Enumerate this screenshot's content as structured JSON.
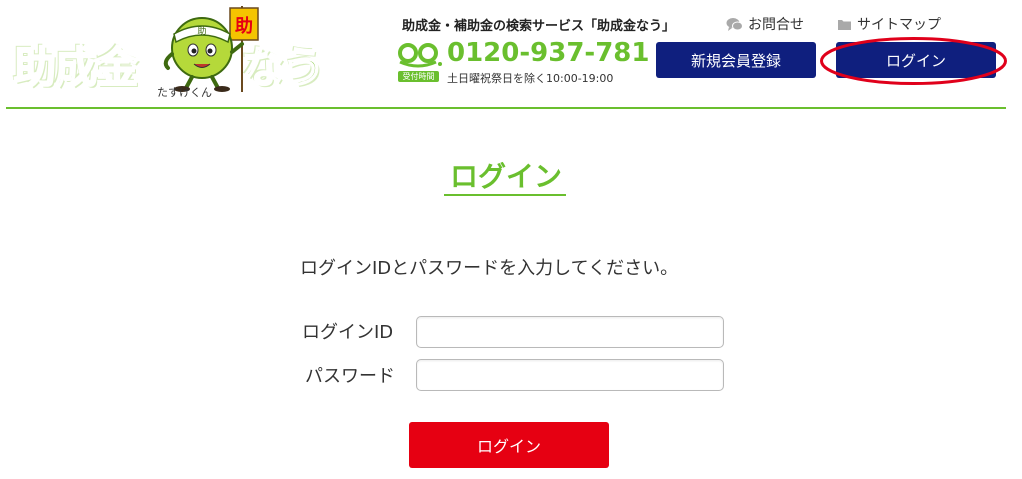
{
  "header": {
    "logo": {
      "text_left": "助成金",
      "text_right": "なう",
      "mascot_flag_char": "助",
      "mascot_headband_char": "助",
      "mascot_caption": "たすけくん"
    },
    "tagline": "助成金・補助金の検索サービス「助成金なう」",
    "utility_links": {
      "contact": "お問合せ",
      "sitemap": "サイトマップ"
    },
    "phone": {
      "number": "0120-937-781",
      "hours_badge": "受付時間",
      "hours": "土日曜祝祭日を除く10:00-19:00"
    },
    "buttons": {
      "register": "新規会員登録",
      "login": "ログイン"
    }
  },
  "main": {
    "title": "ログイン",
    "instruction": "ログインIDとパスワードを入力してください。",
    "form": {
      "id_label": "ログインID",
      "id_value": "",
      "password_label": "パスワード",
      "password_value": "",
      "submit": "ログイン"
    }
  },
  "colors": {
    "brand_green": "#6abf2e",
    "nav_button_blue": "#0f1f7e",
    "submit_red": "#e60012",
    "annotation_red": "#e0001b"
  }
}
